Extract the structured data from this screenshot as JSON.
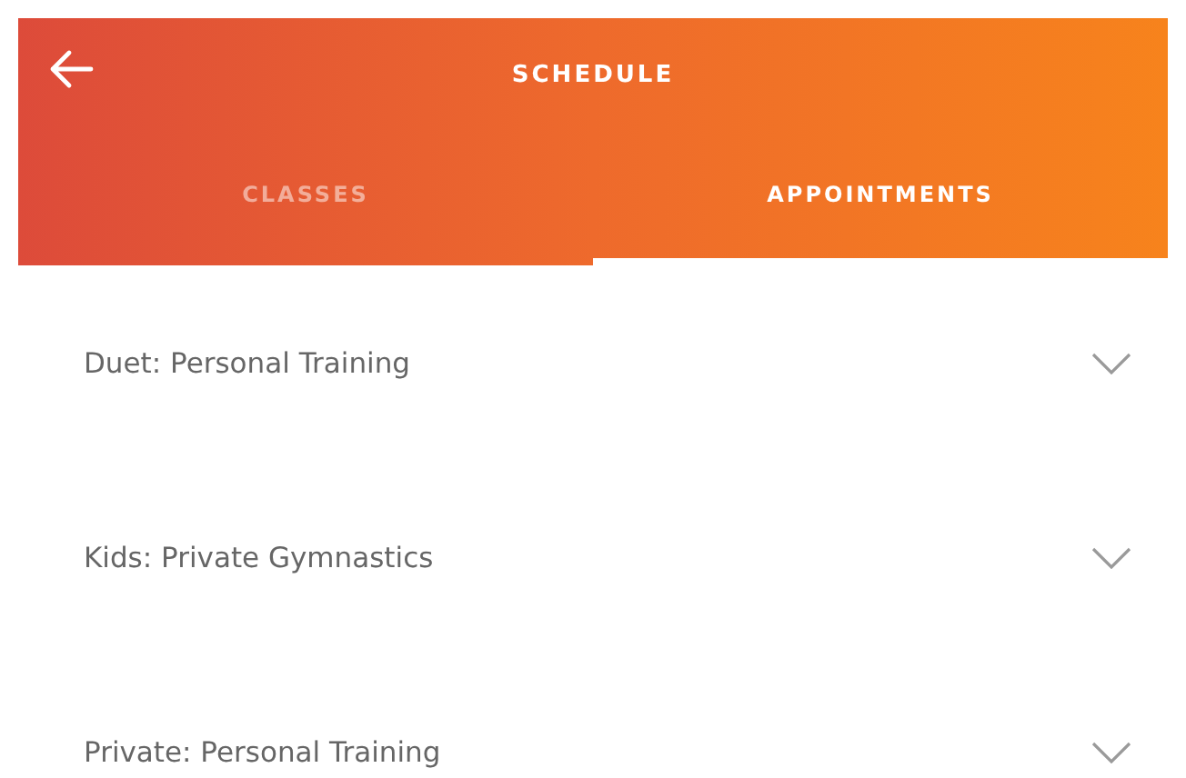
{
  "header": {
    "title": "SCHEDULE"
  },
  "tabs": [
    {
      "label": "CLASSES",
      "selected": false
    },
    {
      "label": "APPOINTMENTS",
      "selected": true
    }
  ],
  "items": [
    {
      "label": "Duet: Personal Training",
      "expanded": false
    },
    {
      "label": "Kids: Private Gymnastics",
      "expanded": false
    },
    {
      "label": "Private: Personal Training",
      "expanded": false
    }
  ]
}
